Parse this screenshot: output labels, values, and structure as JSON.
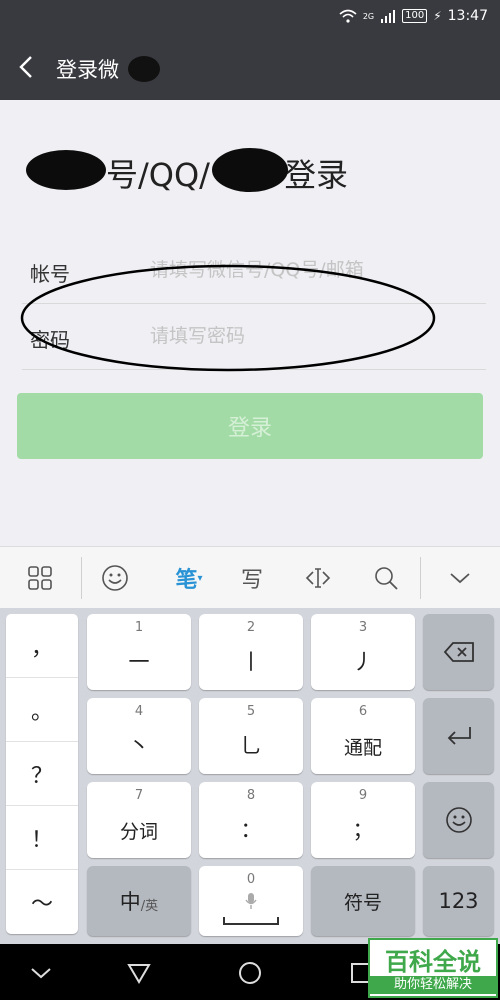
{
  "status_bar": {
    "network_tag": "2G",
    "battery": "100",
    "time": "13:47"
  },
  "header": {
    "title": "登录微",
    "back_icon": "chevron-left-icon"
  },
  "login": {
    "title_parts": [
      "号/QQ/",
      "登录"
    ],
    "account_label": "帐号",
    "account_placeholder": "请填写微信号/QQ号/邮箱",
    "password_label": "密码",
    "password_placeholder": "请填写密码",
    "login_button": "登录",
    "button_color": "#a2dba5"
  },
  "toolbar": {
    "items": [
      "grid-icon",
      "emoji-icon",
      "笔",
      "写",
      "cursor-icon",
      "search-icon",
      "chevron-down-icon"
    ],
    "pen_label": "笔",
    "handwrite_label": "写"
  },
  "keyboard": {
    "punctuation": [
      "，",
      "。",
      "？",
      "！",
      "～"
    ],
    "keys": [
      {
        "num": "1",
        "label": "一"
      },
      {
        "num": "2",
        "label": "丨"
      },
      {
        "num": "3",
        "label": "丿"
      },
      {
        "num": "4",
        "label": "丶"
      },
      {
        "num": "5",
        "label": "乚"
      },
      {
        "num": "6",
        "label": "通配"
      },
      {
        "num": "7",
        "label": "分词"
      },
      {
        "num": "8",
        "label": "："
      },
      {
        "num": "9",
        "label": "；"
      }
    ],
    "zero_num": "0",
    "lang_main": "中",
    "lang_sub": "/英",
    "symbols_label": "符号",
    "numbers_label": "123"
  },
  "watermark": {
    "main": "百科全说",
    "sub": "助你轻松解决",
    "color": "#3ea84a"
  }
}
